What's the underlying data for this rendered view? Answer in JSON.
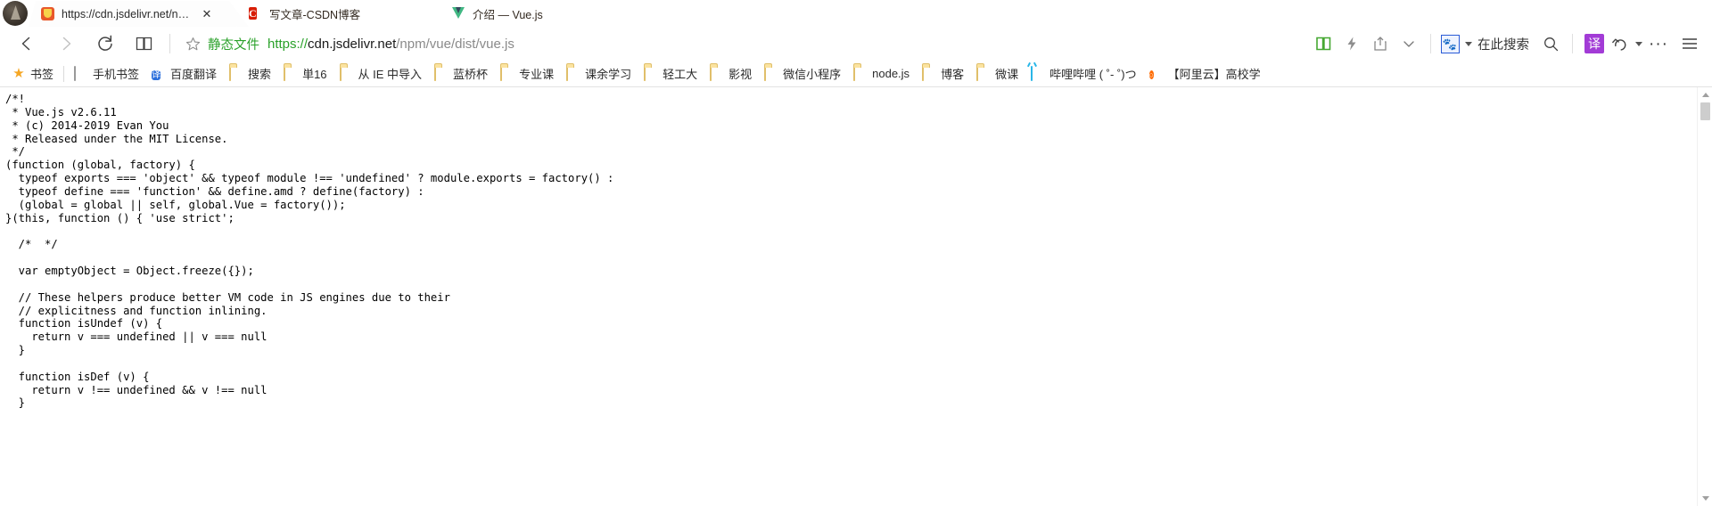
{
  "window": {
    "controls": [
      {
        "name": "theme-shirt-button",
        "glyph": "shirt"
      },
      {
        "name": "minimize-button",
        "glyph": "minimize"
      },
      {
        "name": "maximize-button",
        "glyph": "maximize"
      },
      {
        "name": "close-button",
        "glyph": "close"
      }
    ]
  },
  "tabs": [
    {
      "title": "https://cdn.jsdelivr.net/npm/v",
      "favicon": "jsdelivr-shield-icon",
      "active": true,
      "close": "✕"
    },
    {
      "title": "写文章-CSDN博客",
      "favicon": "csdn-icon",
      "active": false,
      "close": ""
    },
    {
      "title": "介绍 — Vue.js",
      "favicon": "vue-icon",
      "active": false,
      "close": ""
    }
  ],
  "toolbar": {
    "back": "back-arrow",
    "forward": "forward-arrow",
    "refresh": "refresh-arrow",
    "reading_list": "book-icon",
    "star": "☆",
    "url_badge": "静态文件",
    "url": {
      "scheme": "https://",
      "host": "cdn.jsdelivr.net",
      "path": "/npm/vue/dist/vue.js"
    },
    "reading_view_icon": "open-book-icon",
    "flash_icon": "lightning-icon",
    "share_icon": "share-icon",
    "chevron_icon": "chevron-down-icon",
    "baidu_icon": "baidu-paw-icon",
    "search_here": "在此搜索",
    "search_icon": "search-icon",
    "translate_label": "译",
    "history_icon": "history-undo-icon",
    "more_label": "···",
    "menu_icon": "hamburger-menu-icon"
  },
  "bookmarks": [
    {
      "label": "书签",
      "icon": "star-icon"
    },
    {
      "label": "手机书签",
      "icon": "phone-icon"
    },
    {
      "label": "百度翻译",
      "icon": "baidu-translate-icon"
    },
    {
      "label": "搜索",
      "icon": "folder-icon"
    },
    {
      "label": "単16",
      "icon": "folder-icon"
    },
    {
      "label": "从 IE 中导入",
      "icon": "folder-icon"
    },
    {
      "label": "蓝桥杯",
      "icon": "folder-icon"
    },
    {
      "label": "专业课",
      "icon": "folder-icon"
    },
    {
      "label": "课余学习",
      "icon": "folder-icon"
    },
    {
      "label": "轻工大",
      "icon": "folder-icon"
    },
    {
      "label": "影视",
      "icon": "folder-icon"
    },
    {
      "label": "微信小程序",
      "icon": "folder-icon"
    },
    {
      "label": "node.js",
      "icon": "folder-icon"
    },
    {
      "label": "博客",
      "icon": "folder-icon"
    },
    {
      "label": "微课",
      "icon": "folder-icon"
    },
    {
      "label": "哔哩哔哩 ( ˚- ˚)つ",
      "icon": "bilibili-icon"
    },
    {
      "label": "【阿里云】高校学",
      "icon": "aliyun-icon"
    }
  ],
  "page": {
    "code": "/*!\n * Vue.js v2.6.11\n * (c) 2014-2019 Evan You\n * Released under the MIT License.\n */\n(function (global, factory) {\n  typeof exports === 'object' && typeof module !== 'undefined' ? module.exports = factory() :\n  typeof define === 'function' && define.amd ? define(factory) :\n  (global = global || self, global.Vue = factory());\n}(this, function () { 'use strict';\n\n  /*  */\n\n  var emptyObject = Object.freeze({});\n\n  // These helpers produce better VM code in JS engines due to their\n  // explicitness and function inlining.\n  function isUndef (v) {\n    return v === undefined || v === null\n  }\n\n  function isDef (v) {\n    return v !== undefined && v !== null\n  }"
  },
  "colors": {
    "url_green": "#2aa12a",
    "translate_purple": "#a23bd6",
    "baidu_blue": "#2a5bd7",
    "vue_green": "#41b883",
    "csdn_red": "#d81e06"
  }
}
